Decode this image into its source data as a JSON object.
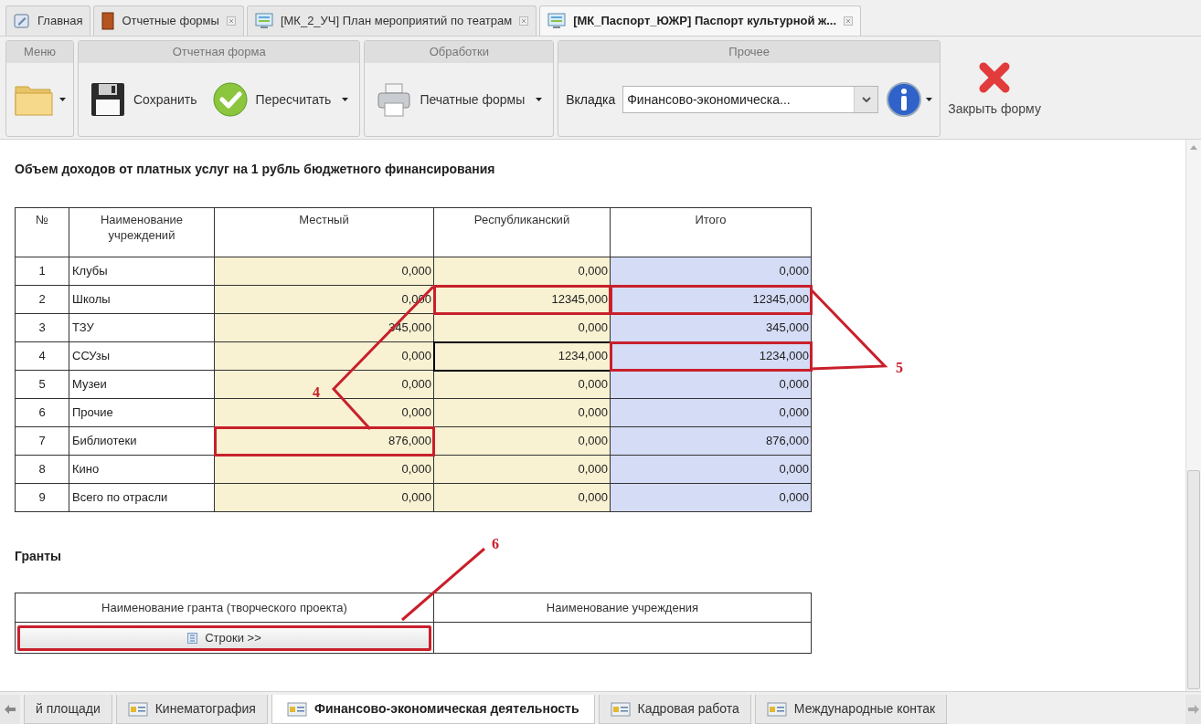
{
  "top_tabs": [
    {
      "label": "Главная",
      "closable": false,
      "selected": false
    },
    {
      "label": "Отчетные формы",
      "closable": true,
      "selected": false
    },
    {
      "label": "[МК_2_УЧ] План мероприятий по театрам",
      "closable": true,
      "selected": false
    },
    {
      "label": "[МК_Паспорт_ЮЖР] Паспорт культурной ж...",
      "closable": true,
      "selected": true
    }
  ],
  "toolbar": {
    "groups": [
      {
        "title": "Меню",
        "kind": "menu"
      },
      {
        "title": "Отчетная форма",
        "kind": "form",
        "buttons": [
          {
            "label": "Сохранить",
            "dropdown": false
          },
          {
            "label": "Пересчитать",
            "dropdown": true
          }
        ]
      },
      {
        "title": "Обработки",
        "kind": "print",
        "buttons": [
          {
            "label": "Печатные формы",
            "dropdown": true
          }
        ]
      },
      {
        "title": "Прочее",
        "kind": "other",
        "field_label": "Вкладка",
        "select_value": "Финансово-экономическа..."
      }
    ],
    "close_button": "Закрыть форму"
  },
  "section_title": "Объем доходов от платных услуг на 1 рубль бюджетного финансирования",
  "table": {
    "columns": [
      "№",
      "Наименование учреждений",
      "Местный",
      "Республиканский",
      "Итого"
    ],
    "rows": [
      {
        "cells": [
          {
            "value": "1",
            "highlighted": false,
            "selected": false
          },
          {
            "value": "Клубы",
            "highlighted": false,
            "selected": false
          },
          {
            "value": "0,000",
            "highlighted": false,
            "selected": false
          },
          {
            "value": "0,000",
            "highlighted": false,
            "selected": false
          },
          {
            "value": "0,000",
            "highlighted": false,
            "selected": false
          }
        ]
      },
      {
        "cells": [
          {
            "value": "2",
            "highlighted": false,
            "selected": false
          },
          {
            "value": "Школы",
            "highlighted": false,
            "selected": false
          },
          {
            "value": "0,000",
            "highlighted": false,
            "selected": false
          },
          {
            "value": "12345,000",
            "highlighted": true,
            "selected": false
          },
          {
            "value": "12345,000",
            "highlighted": true,
            "selected": false
          }
        ]
      },
      {
        "cells": [
          {
            "value": "3",
            "highlighted": false,
            "selected": false
          },
          {
            "value": "ТЗУ",
            "highlighted": false,
            "selected": false
          },
          {
            "value": "345,000",
            "highlighted": false,
            "selected": false
          },
          {
            "value": "0,000",
            "highlighted": false,
            "selected": false
          },
          {
            "value": "345,000",
            "highlighted": false,
            "selected": false
          }
        ]
      },
      {
        "cells": [
          {
            "value": "4",
            "highlighted": false,
            "selected": false
          },
          {
            "value": "ССУзы",
            "highlighted": false,
            "selected": false
          },
          {
            "value": "0,000",
            "highlighted": false,
            "selected": false
          },
          {
            "value": "1234,000",
            "highlighted": false,
            "selected": true
          },
          {
            "value": "1234,000",
            "highlighted": true,
            "selected": false
          }
        ]
      },
      {
        "cells": [
          {
            "value": "5",
            "highlighted": false,
            "selected": false
          },
          {
            "value": "Музеи",
            "highlighted": false,
            "selected": false
          },
          {
            "value": "0,000",
            "highlighted": false,
            "selected": false
          },
          {
            "value": "0,000",
            "highlighted": false,
            "selected": false
          },
          {
            "value": "0,000",
            "highlighted": false,
            "selected": false
          }
        ]
      },
      {
        "cells": [
          {
            "value": "6",
            "highlighted": false,
            "selected": false
          },
          {
            "value": "Прочие",
            "highlighted": false,
            "selected": false
          },
          {
            "value": "0,000",
            "highlighted": false,
            "selected": false
          },
          {
            "value": "0,000",
            "highlighted": false,
            "selected": false
          },
          {
            "value": "0,000",
            "highlighted": false,
            "selected": false
          }
        ]
      },
      {
        "cells": [
          {
            "value": "7",
            "highlighted": false,
            "selected": false
          },
          {
            "value": "Библиотеки",
            "highlighted": false,
            "selected": false
          },
          {
            "value": "876,000",
            "highlighted": true,
            "selected": false
          },
          {
            "value": "0,000",
            "highlighted": false,
            "selected": false
          },
          {
            "value": "876,000",
            "highlighted": false,
            "selected": false
          }
        ]
      },
      {
        "cells": [
          {
            "value": "8",
            "highlighted": false,
            "selected": false
          },
          {
            "value": "Кино",
            "highlighted": false,
            "selected": false
          },
          {
            "value": "0,000",
            "highlighted": false,
            "selected": false
          },
          {
            "value": "0,000",
            "highlighted": false,
            "selected": false
          },
          {
            "value": "0,000",
            "highlighted": false,
            "selected": false
          }
        ]
      },
      {
        "cells": [
          {
            "value": "9",
            "highlighted": false,
            "selected": false
          },
          {
            "value": "Всего по отрасли",
            "highlighted": false,
            "selected": false
          },
          {
            "value": "0,000",
            "highlighted": false,
            "selected": false
          },
          {
            "value": "0,000",
            "highlighted": false,
            "selected": false
          },
          {
            "value": "0,000",
            "highlighted": false,
            "selected": false
          }
        ]
      }
    ]
  },
  "grants": {
    "title": "Гранты",
    "columns": [
      "Наименование гранта (творческого проекта)",
      "Наименование учреждения"
    ],
    "rows_button": "Строки >>",
    "rows_button_highlighted": true
  },
  "callouts": [
    {
      "label": "4"
    },
    {
      "label": "5"
    },
    {
      "label": "6"
    }
  ],
  "bottom_tabs": [
    {
      "label": "й площади",
      "selected": false,
      "icon": false
    },
    {
      "label": "Кинематография",
      "selected": false,
      "icon": true
    },
    {
      "label": "Финансово-экономическая деятельность",
      "selected": true,
      "icon": true
    },
    {
      "label": "Кадровая работа",
      "selected": false,
      "icon": true
    },
    {
      "label": "Международные контак",
      "selected": false,
      "icon": true
    }
  ]
}
